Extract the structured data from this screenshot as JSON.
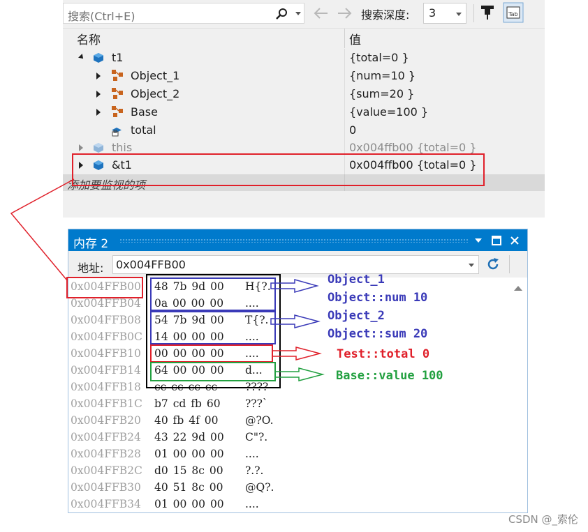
{
  "watch": {
    "search_placeholder": "搜索(Ctrl+E)",
    "depth_label": "搜索深度:",
    "depth_value": "3",
    "col_name": "名称",
    "col_value": "值",
    "rows": [
      {
        "name": "t1",
        "value": "{total=0 }"
      },
      {
        "name": "Object_1",
        "value": "{num=10 }"
      },
      {
        "name": "Object_2",
        "value": "{sum=20 }"
      },
      {
        "name": "Base",
        "value": "{value=100 }"
      },
      {
        "name": "total",
        "value": "0"
      },
      {
        "name": "this",
        "value": "0x004ffb00 {total=0 }"
      },
      {
        "name": "&t1",
        "value": "0x004ffb00 {total=0 }"
      }
    ],
    "add_watch": "添加要监视的项"
  },
  "memory": {
    "title": "内存 2",
    "address_label": "地址:",
    "address_value": "0x004FFB00",
    "lines": [
      {
        "addr": "0x004FFB00",
        "hex": "48 7b 9d 00",
        "ascii": "H{?."
      },
      {
        "addr": "0x004FFB04",
        "hex": "0a 00 00 00",
        "ascii": "...."
      },
      {
        "addr": "0x004FFB08",
        "hex": "54 7b 9d 00",
        "ascii": "T{?."
      },
      {
        "addr": "0x004FFB0C",
        "hex": "14 00 00 00",
        "ascii": "...."
      },
      {
        "addr": "0x004FFB10",
        "hex": "00 00 00 00",
        "ascii": "...."
      },
      {
        "addr": "0x004FFB14",
        "hex": "64 00 00 00",
        "ascii": "d..."
      },
      {
        "addr": "0x004FFB18",
        "hex": "cc cc cc cc",
        "ascii": "????"
      },
      {
        "addr": "0x004FFB1C",
        "hex": "b7 cd fb 60",
        "ascii": "???`"
      },
      {
        "addr": "0x004FFB20",
        "hex": "40 fb 4f 00",
        "ascii": "@?O."
      },
      {
        "addr": "0x004FFB24",
        "hex": "43 22 9d 00",
        "ascii": "C\"?."
      },
      {
        "addr": "0x004FFB28",
        "hex": "01 00 00 00",
        "ascii": "...."
      },
      {
        "addr": "0x004FFB2C",
        "hex": "d0 15 8c 00",
        "ascii": "?.?."
      },
      {
        "addr": "0x004FFB30",
        "hex": "40 51 8c 00",
        "ascii": "@Q?."
      },
      {
        "addr": "0x004FFB34",
        "hex": "01 00 00 00",
        "ascii": "...."
      }
    ]
  },
  "annotations": {
    "obj1_title": "Object_1",
    "obj1_member": "Object::num 10",
    "obj2_title": "Object_2",
    "obj2_member": "Object::sum 20",
    "test_total": "Test::total 0",
    "base_value": "Base::value 100"
  },
  "watermark": "CSDN @_索伦",
  "colors": {
    "accent": "#007acc",
    "annot_blue": "#3a3ab8",
    "annot_red": "#e0202a",
    "annot_green": "#22a040",
    "cube_blue": "#1e73be"
  },
  "icons": [
    "search-icon",
    "back-arrow-icon",
    "forward-arrow-icon",
    "pin-icon",
    "tab-icon",
    "refresh-icon",
    "cube-icon",
    "base-class-icon",
    "field-icon"
  ]
}
